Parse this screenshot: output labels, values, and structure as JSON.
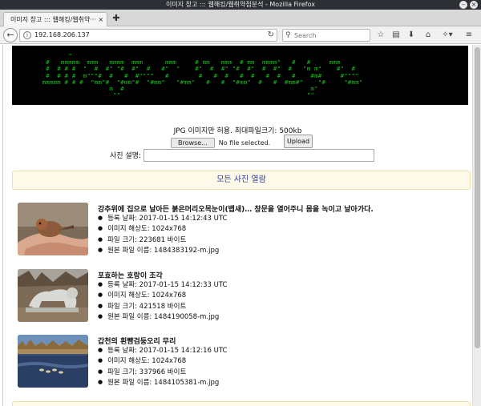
{
  "window": {
    "title": "이미지 창고 ::: 웹해킹/웹취약점분석 - Mozilla Firefox"
  },
  "tab": {
    "label": "이미지 창고 ::: 웹해킹/웹취약··· ×"
  },
  "navbar": {
    "url": "192.168.206.137",
    "search_placeholder": "Search"
  },
  "banner": {
    "art": "        \"\n  #   mmmmm  mmm   mmmm  mmm      mmm     # mm   mmm  # mm  mmmm\"   #   #     mmm\n  #  # # #  \"  #  #\" \"#  #\"  #   #\"  \"    #\"  #  #\" \"#  #\"  #  #\"  #   \"m m\"    #\"  #\n  #  # # #  m\"\"\"#  #   #  #\"\"\"\"   #        #   #  #   #  #   #  #   #    #m#     #\"\"\"\"\n mmmmm # # #  \"mm\"#  \"#mm\"#  \"#mm\"   \"#mm\"   #   #  \"#mm\"  #   #  #mm#\"    \"#     \"#mm\"\n                   m  #                                                  m\"\n                    \"\"                                                  \"\""
  },
  "upload": {
    "info": "JPG 이미지만 허용. 최대파일크기: 500kb",
    "browse_label": "Browse...",
    "file_status": "No file selected.",
    "upload_label": "Upload",
    "desc_label": "사진 설명:",
    "desc_value": ""
  },
  "all_photos_label": "모든 사진 열람",
  "entries": [
    {
      "title": "강추위에 집으로 날아든 붉은머리오목눈이(뱁새)… 창문을 열어주니 몸을 녹이고 날아가다.",
      "date": "등록 날짜: 2017-01-15 14:12:43 UTC",
      "resolution": "이미지 해상도: 1024x768",
      "size": "파일 크기: 223681 바이트",
      "filename": "원본 파일 이름: 1484383192-m.jpg"
    },
    {
      "title": "포효하는 호랑이 조각",
      "date": "등록 날짜: 2017-01-15 14:12:33 UTC",
      "resolution": "이미지 해상도: 1024x768",
      "size": "파일 크기: 421518 바이트",
      "filename": "원본 파일 이름: 1484190058-m.jpg"
    },
    {
      "title": "갑천의 흰뺨검둥오리 무리",
      "date": "등록 날짜: 2017-01-15 14:12:16 UTC",
      "resolution": "이미지 해상도: 1024x768",
      "size": "파일 크기: 337966 바이트",
      "filename": "원본 파일 이름: 1484105381-m.jpg"
    }
  ],
  "colors": {
    "banner_bg": "#000000",
    "banner_text": "#19c11c",
    "panel_bg": "#fff9e9",
    "panel_text": "#2a3e93"
  },
  "icons": {
    "back": "back-arrow-icon",
    "info": "info-icon",
    "reload": "reload-icon",
    "search": "search-icon",
    "bookmark_star": "star-icon",
    "reader": "clipboard-icon",
    "download": "download-icon",
    "home": "home-icon",
    "extensions": "puzzle-icon",
    "menu": "hamburger-menu-icon"
  }
}
